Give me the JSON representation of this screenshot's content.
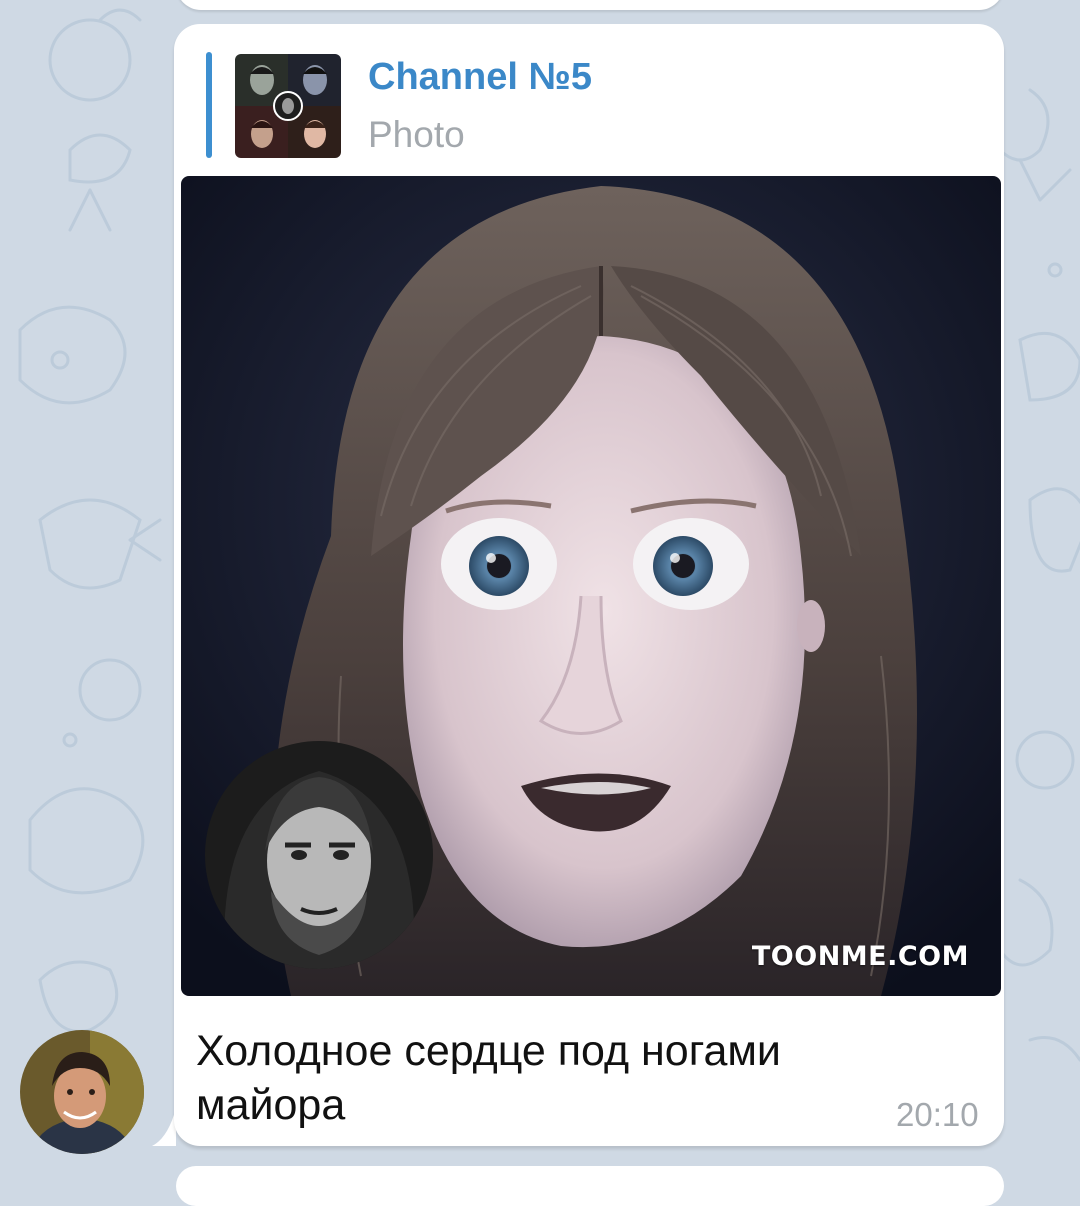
{
  "app": "Telegram",
  "colors": {
    "chat_background": "#cfd9e4",
    "bubble": "#ffffff",
    "accent": "#3d8fd0",
    "link_title": "#3b88c8",
    "meta_gray": "#a3a8ad"
  },
  "message": {
    "forwarded": {
      "channel_name": "Channel №5",
      "media_type": "Photo"
    },
    "photo": {
      "watermark": "TOONME.COM"
    },
    "caption_line1": "Холодное сердце под ногами",
    "caption_line2": "майора",
    "time": "20:10"
  },
  "icons": {
    "channel_avatar": "channel-thumbnail-icon",
    "sender_avatar": "user-avatar-icon"
  }
}
